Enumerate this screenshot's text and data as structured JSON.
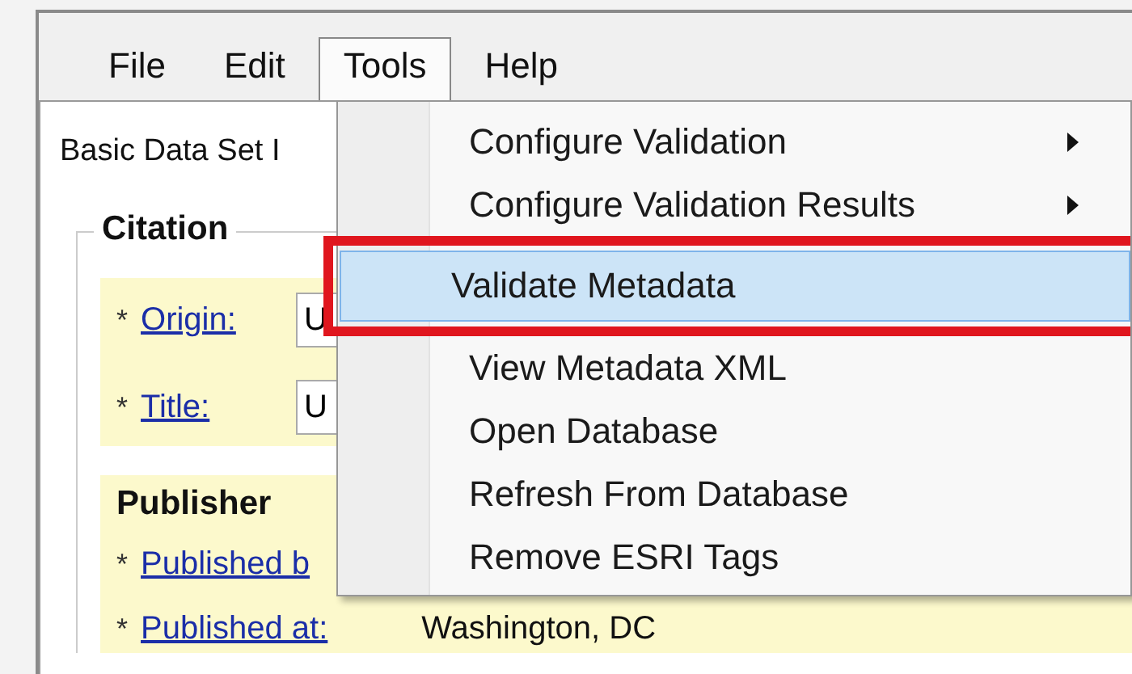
{
  "menu_bar": [
    {
      "label": "File",
      "selected": false
    },
    {
      "label": "Edit",
      "selected": false
    },
    {
      "label": "Tools",
      "selected": true
    },
    {
      "label": "Help",
      "selected": false
    }
  ],
  "tab_label": "Basic Data Set I",
  "citation": {
    "title": "Citation",
    "fields": [
      {
        "marker": "*",
        "label": "Origin:",
        "value": "U"
      },
      {
        "marker": "*",
        "label": "Title:",
        "value": "U"
      }
    ]
  },
  "publisher": {
    "title": "Publisher",
    "fields": [
      {
        "marker": "*",
        "label": "Published b"
      },
      {
        "marker": "*",
        "label": "Published at:",
        "value": "Washington, DC"
      }
    ]
  },
  "tools_menu": [
    {
      "label": "Configure Validation",
      "has_submenu": true,
      "selected": false
    },
    {
      "label": "Configure Validation Results",
      "has_submenu": true,
      "selected": false
    },
    {
      "label": "Validate Metadata",
      "has_submenu": false,
      "selected": true
    },
    {
      "label": "View Metadata XML",
      "has_submenu": false,
      "selected": false
    },
    {
      "label": "Open Database",
      "has_submenu": false,
      "selected": false
    },
    {
      "label": "Refresh From Database",
      "has_submenu": false,
      "selected": false
    },
    {
      "label": "Remove ESRI Tags",
      "has_submenu": false,
      "selected": false
    }
  ]
}
